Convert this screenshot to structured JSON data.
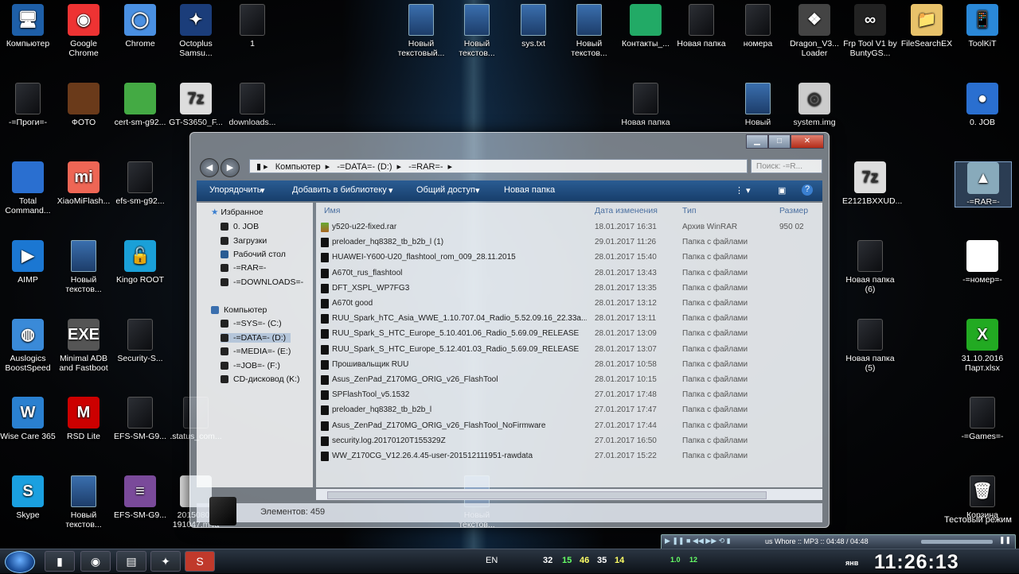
{
  "desktop_icons": [
    {
      "label": "Компьютер",
      "glyph": "🖥"
    },
    {
      "label": "Google Chrome",
      "glyph": "◉"
    },
    {
      "label": "Chrome",
      "glyph": "◯"
    },
    {
      "label": "Octoplus Samsu...",
      "glyph": "✦"
    },
    {
      "label": "1",
      "glyph": ""
    },
    {
      "label": "Новый текстовый...",
      "glyph": ""
    },
    {
      "label": "Новый текстов...",
      "glyph": ""
    },
    {
      "label": "sys.txt",
      "glyph": ""
    },
    {
      "label": "Новый текстов...",
      "glyph": ""
    },
    {
      "label": "Контакты_...",
      "glyph": ""
    },
    {
      "label": "Новая папка",
      "glyph": ""
    },
    {
      "label": "номера",
      "glyph": ""
    },
    {
      "label": "Dragon_V3... Loader",
      "glyph": "❖"
    },
    {
      "label": "Frp Tool V1 by BuntyGS...",
      "glyph": "∞"
    },
    {
      "label": "FileSearchEX",
      "glyph": "📁"
    },
    {
      "label": "ToolKiT",
      "glyph": "📱"
    },
    {
      "label": "-=Проги=-",
      "glyph": ""
    },
    {
      "label": "ФОТО",
      "glyph": ""
    },
    {
      "label": "cert-sm-g92...",
      "glyph": ""
    },
    {
      "label": "GT-S3650_F...",
      "glyph": "7z"
    },
    {
      "label": "downloads...",
      "glyph": ""
    },
    {
      "label": "Новая папка",
      "glyph": ""
    },
    {
      "label": "Новый",
      "glyph": ""
    },
    {
      "label": "system.img",
      "glyph": "◎"
    },
    {
      "label": "0. JOB",
      "glyph": "●"
    },
    {
      "label": "Total Command...",
      "glyph": ""
    },
    {
      "label": "XiaoMiFlash...",
      "glyph": "mi"
    },
    {
      "label": "efs-sm-g92...",
      "glyph": ""
    },
    {
      "label": "E2121BXXUD...",
      "glyph": "7z"
    },
    {
      "label": "-=RAR=-",
      "glyph": "▲"
    },
    {
      "label": "AIMP",
      "glyph": "▶"
    },
    {
      "label": "Новый текстов...",
      "glyph": ""
    },
    {
      "label": "Kingo ROOT",
      "glyph": "🔓"
    },
    {
      "label": "Новая папка (6)",
      "glyph": ""
    },
    {
      "label": "-=номер=-",
      "glyph": ""
    },
    {
      "label": "Auslogics BoostSpeed",
      "glyph": "◍"
    },
    {
      "label": "Minimal ADB and Fastboot",
      "glyph": "EXE"
    },
    {
      "label": "Security-S...",
      "glyph": ""
    },
    {
      "label": "Новая папка (5)",
      "glyph": ""
    },
    {
      "label": "31.10.2016 Парт.xlsx",
      "glyph": "X"
    },
    {
      "label": "Wise Care 365",
      "glyph": "W"
    },
    {
      "label": "RSD Lite",
      "glyph": "M"
    },
    {
      "label": "EFS-SM-G9...",
      "glyph": ""
    },
    {
      "label": ".status_com...",
      "glyph": ""
    },
    {
      "label": "-=Games=-",
      "glyph": ""
    },
    {
      "label": "Skype",
      "glyph": "S"
    },
    {
      "label": "Новый текстов...",
      "glyph": ""
    },
    {
      "label": "EFS-SM-G9...",
      "glyph": "≡"
    },
    {
      "label": "20150808 191047.m4a",
      "glyph": ""
    },
    {
      "label": "Новый текстов...",
      "glyph": ""
    },
    {
      "label": "Корзина",
      "glyph": "🗑"
    }
  ],
  "explorer": {
    "address": [
      "Компьютер",
      "-=DATA=- (D:)",
      "-=RAR=-"
    ],
    "search_placeholder": "Поиск: -=R...",
    "toolbar": {
      "organize": "Упорядочить",
      "library": "Добавить в библиотеку",
      "share": "Общий доступ",
      "new_folder": "Новая папка"
    },
    "sidebar": {
      "favorites": "Избранное",
      "fav_items": [
        "0. JOB",
        "Загрузки",
        "Рабочий стол",
        "-=RAR=-",
        "-=DOWNLOADS=-"
      ],
      "computer": "Компьютер",
      "drives": [
        "-=SYS=- (C:)",
        "-=DATA=- (D:)",
        "-=MEDIA=- (E:)",
        "-=JOB=- (F:)",
        "CD-дисковод (K:)"
      ]
    },
    "columns": {
      "name": "Имя",
      "date": "Дата изменения",
      "type": "Тип",
      "size": "Размер"
    },
    "files": [
      {
        "name": "y520-u22-fixed.rar",
        "date": "18.01.2017 16:31",
        "type": "Архив WinRAR",
        "size": "950 02"
      },
      {
        "name": "preloader_hq8382_tb_b2b_l (1)",
        "date": "29.01.2017 11:26",
        "type": "Папка с файлами",
        "size": ""
      },
      {
        "name": "HUAWEI-Y600-U20_flashtool_rom_009_28.11.2015",
        "date": "28.01.2017 15:40",
        "type": "Папка с файлами",
        "size": ""
      },
      {
        "name": "A670t_rus_flashtool",
        "date": "28.01.2017 13:43",
        "type": "Папка с файлами",
        "size": ""
      },
      {
        "name": "DFT_XSPL_WP7FG3",
        "date": "28.01.2017 13:35",
        "type": "Папка с файлами",
        "size": ""
      },
      {
        "name": "A670t good",
        "date": "28.01.2017 13:12",
        "type": "Папка с файлами",
        "size": ""
      },
      {
        "name": "RUU_Spark_hTC_Asia_WWE_1.10.707.04_Radio_5.52.09.16_22.33a...",
        "date": "28.01.2017 13:11",
        "type": "Папка с файлами",
        "size": ""
      },
      {
        "name": "RUU_Spark_S_HTC_Europe_5.10.401.06_Radio_5.69.09_RELEASE",
        "date": "28.01.2017 13:09",
        "type": "Папка с файлами",
        "size": ""
      },
      {
        "name": "RUU_Spark_S_HTC_Europe_5.12.401.03_Radio_5.69.09_RELEASE",
        "date": "28.01.2017 13:07",
        "type": "Папка с файлами",
        "size": ""
      },
      {
        "name": "Прошивальщик RUU",
        "date": "28.01.2017 10:58",
        "type": "Папка с файлами",
        "size": ""
      },
      {
        "name": "Asus_ZenPad_Z170MG_ORIG_v26_FlashTool",
        "date": "28.01.2017 10:15",
        "type": "Папка с файлами",
        "size": ""
      },
      {
        "name": "SPFlashTool_v5.1532",
        "date": "27.01.2017 17:48",
        "type": "Папка с файлами",
        "size": ""
      },
      {
        "name": "preloader_hq8382_tb_b2b_l",
        "date": "27.01.2017 17:47",
        "type": "Папка с файлами",
        "size": ""
      },
      {
        "name": "Asus_ZenPad_Z170MG_ORIG_v26_FlashTool_NoFirmware",
        "date": "27.01.2017 17:44",
        "type": "Папка с файлами",
        "size": ""
      },
      {
        "name": "security.log.20170120T155329Z",
        "date": "27.01.2017 16:50",
        "type": "Папка с файлами",
        "size": ""
      },
      {
        "name": "WW_Z170CG_V12.26.4.45-user-201512111951-rawdata",
        "date": "27.01.2017 15:22",
        "type": "Папка с файлами",
        "size": ""
      }
    ],
    "status": "Элементов: 459"
  },
  "taskbar": {
    "lang": "EN",
    "tray_numbers": [
      "32",
      "15",
      "46",
      "35",
      "14"
    ],
    "tray_small": [
      "1.0",
      "12"
    ],
    "clock": "11:26:13",
    "player_text": "us Whore :: MP3 :: 04:48 / 04:48",
    "test_mode": "Тестовый режим",
    "date_frag": "янв"
  }
}
